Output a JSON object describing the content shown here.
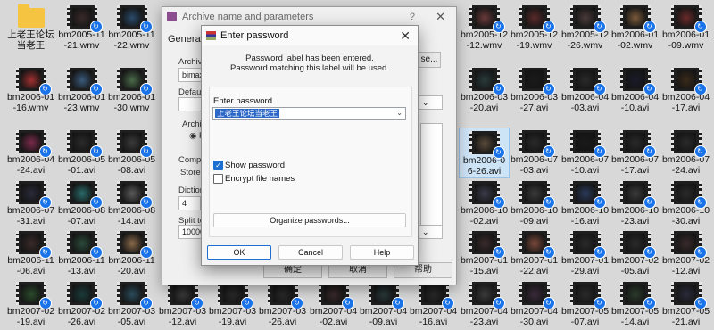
{
  "folder": {
    "label": "上老王论坛当老王"
  },
  "files": [
    "bm2005-11-21.wmv",
    "bm2005-11-22.wmv",
    "bm2005-12-12.wmv",
    "bm2005-12-19.wmv",
    "bm2005-12-26.wmv",
    "bm2006-01-02.wmv",
    "bm2006-01-09.wmv",
    "bm2006-01-16.wmv",
    "bm2006-01-23.wmv",
    "bm2006-01-30.wmv",
    "bm2006-03-20.avi",
    "bm2006-03-27.avi",
    "bm2006-04-03.avi",
    "bm2006-04-10.avi",
    "bm2006-04-17.avi",
    "bm2006-04-24.avi",
    "bm2006-05-01.avi",
    "bm2006-05-08.avi",
    "bm2006-06-26.avi",
    "bm2006-07-03.avi",
    "bm2006-07-10.avi",
    "bm2006-07-17.avi",
    "bm2006-07-24.avi",
    "bm2006-07-31.avi",
    "bm2006-08-07.avi",
    "bm2006-08-14.avi",
    "bm2006-10-02.avi",
    "bm2006-10-09.avi",
    "bm2006-10-16.avi",
    "bm2006-10-23.avi",
    "bm2006-10-30.avi",
    "bm2006-11-06.avi",
    "bm2006-11-13.avi",
    "bm2006-11-20.avi",
    "bm2007-01-15.avi",
    "bm2007-01-22.avi",
    "bm2007-01-29.avi",
    "bm2007-02-05.avi",
    "bm2007-02-12.avi",
    "bm2007-02-19.avi",
    "bm2007-02-26.avi",
    "bm2007-03-05.avi",
    "bm2007-03-12.avi",
    "bm2007-03-19.avi",
    "bm2007-03-26.avi",
    "bm2007-04-02.avi",
    "bm2007-04-09.avi",
    "bm2007-04-16.avi",
    "bm2007-04-23.avi",
    "bm2007-04-30.avi",
    "bm2007-05-07.avi",
    "bm2007-05-14.avi",
    "bm2007-05-21.avi"
  ],
  "thumb_colors": [
    "#3a2a2a",
    "#2a4a6a",
    "#6a3a3a",
    "#5a2a2a",
    "#4a3a3a",
    "#7a5a3a",
    "#6a2a2a",
    "#a03030",
    "#3a5a7a",
    "#4a6a4a",
    "#2a3a3a",
    "#1a1a1a",
    "#2a2a2a",
    "#1a1a2a",
    "#3a2a1a",
    "#7a2a4a",
    "#2a2a2a",
    "#3a3a3a",
    "#5a4a3a",
    "#2a2a2a",
    "#1a1a1a",
    "#2a2a2a",
    "#2a2a2a",
    "#2a2a3a",
    "#2a6a6a",
    "#5a5a5a",
    "#3a3a4a",
    "#3a3a3a",
    "#2a3a5a",
    "#3a3a3a",
    "#2a2a2a",
    "#3a2a2a",
    "#2a4a3a",
    "#8a6a4a",
    "#3a2a2a",
    "#7a4a3a",
    "#2a2a2a",
    "#2a2a2a",
    "#3a2a2a",
    "#2a4a2a",
    "#1a3a3a",
    "#2a4a5a",
    "#3a3a3a",
    "#2a2a2a",
    "#2a2a2a",
    "#3a2a2a",
    "#2a3a3a",
    "#2a2a2a",
    "#3a3a3a",
    "#3a2a3a",
    "#2a2a2a",
    "#2a3a2a",
    "#2a2a3a"
  ],
  "bg_dialog": {
    "title": "Archive name and parameters",
    "help_glyph": "?",
    "close_glyph": "✕",
    "tab_general": "General",
    "archive_label": "Archive",
    "archive_value": "bimaxi",
    "browse_label": "se...",
    "default_label": "Default",
    "archive_format_label": "Archiv",
    "radio_label": "R",
    "compression_label": "Compre",
    "compression_value": "Store",
    "dictionary_label": "Dictiona",
    "dictionary_value": "4",
    "split_label": "Split to",
    "split_value": "10000",
    "ok": "确定",
    "cancel": "取消",
    "help": "帮助"
  },
  "dialog": {
    "title": "Enter password",
    "close_glyph": "✕",
    "message_line1": "Password label has been entered.",
    "message_line2": "Password matching this label will be used.",
    "enter_password_label": "Enter password",
    "password_value": "上老王论坛当老王",
    "show_password_label": "Show password",
    "show_password_checked": true,
    "encrypt_names_label": "Encrypt file names",
    "encrypt_names_checked": false,
    "organize_button": "Organize passwords...",
    "ok_button": "OK",
    "cancel_button": "Cancel",
    "help_button": "Help"
  }
}
